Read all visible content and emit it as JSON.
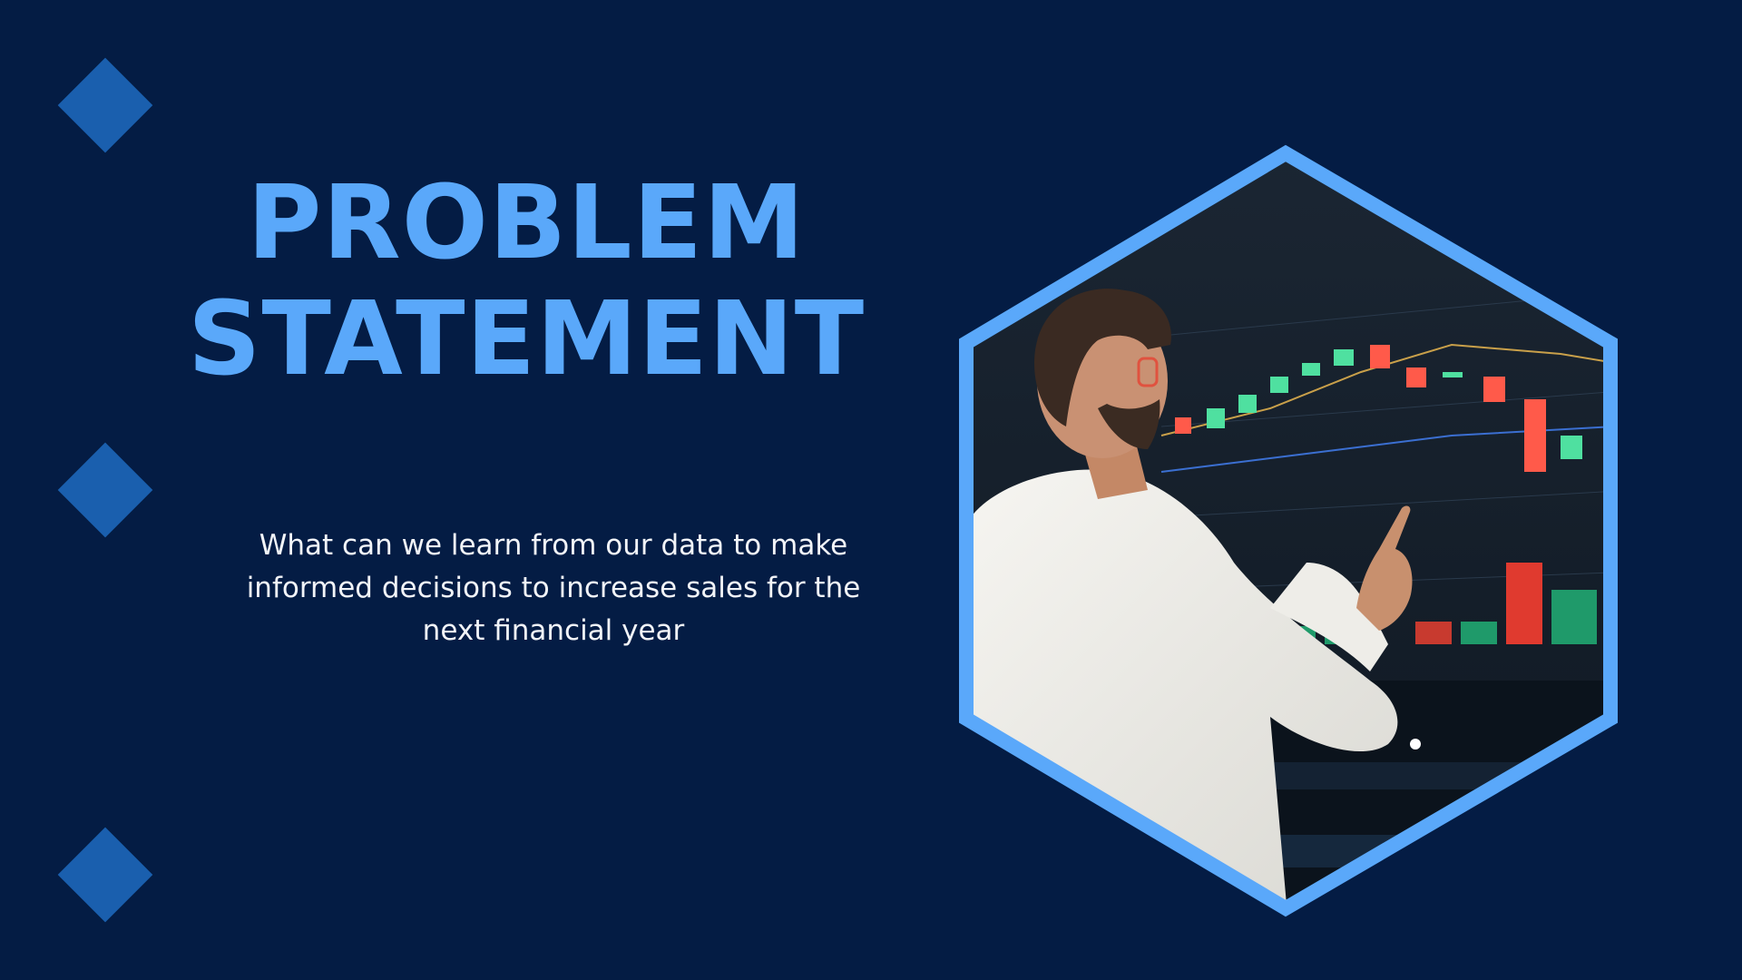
{
  "slide": {
    "title_line1": "PROBLEM",
    "title_line2": "STATEMENT",
    "body": "What can we learn from our data to make informed decisions to increase sales for the next financial year"
  },
  "colors": {
    "background": "#041c44",
    "accent": "#5aa8fa",
    "diamond": "#1a5fae",
    "text": "#f2f4f8"
  },
  "photo": {
    "description_icon": "hexagon-photo-icon"
  }
}
